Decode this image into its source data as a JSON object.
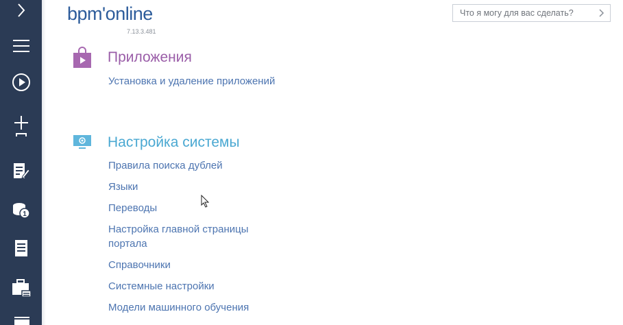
{
  "header": {
    "logo": "bpm'online",
    "version": "7.13.3.481"
  },
  "search": {
    "placeholder": "Что я могу для вас сделать?"
  },
  "sidebar": {
    "items": [
      {
        "icon": "chevron-right-icon"
      },
      {
        "icon": "menu-icon"
      },
      {
        "icon": "play-icon"
      },
      {
        "icon": "add-icon"
      },
      {
        "icon": "edit-document-icon"
      },
      {
        "icon": "coins-icon",
        "badge": "1"
      },
      {
        "icon": "document-icon"
      },
      {
        "icon": "briefcase-icon"
      },
      {
        "icon": "card-icon"
      }
    ]
  },
  "sections": [
    {
      "title": "Приложения",
      "title_color": "#9a5da8",
      "icon": "shopping-bag-icon",
      "links": [
        "Установка и удаление приложений"
      ]
    },
    {
      "title": "Настройка системы",
      "title_color": "#4aa8d2",
      "icon": "monitor-gear-icon",
      "links": [
        "Правила поиска дублей",
        "Языки",
        "Переводы",
        "Настройка главной страницы портала",
        "Справочники",
        "Системные настройки",
        "Модели машинного обучения"
      ]
    }
  ],
  "colors": {
    "sidebar": "#2b3b55",
    "link": "#4c74b0",
    "logo": "#2d5c9b"
  }
}
